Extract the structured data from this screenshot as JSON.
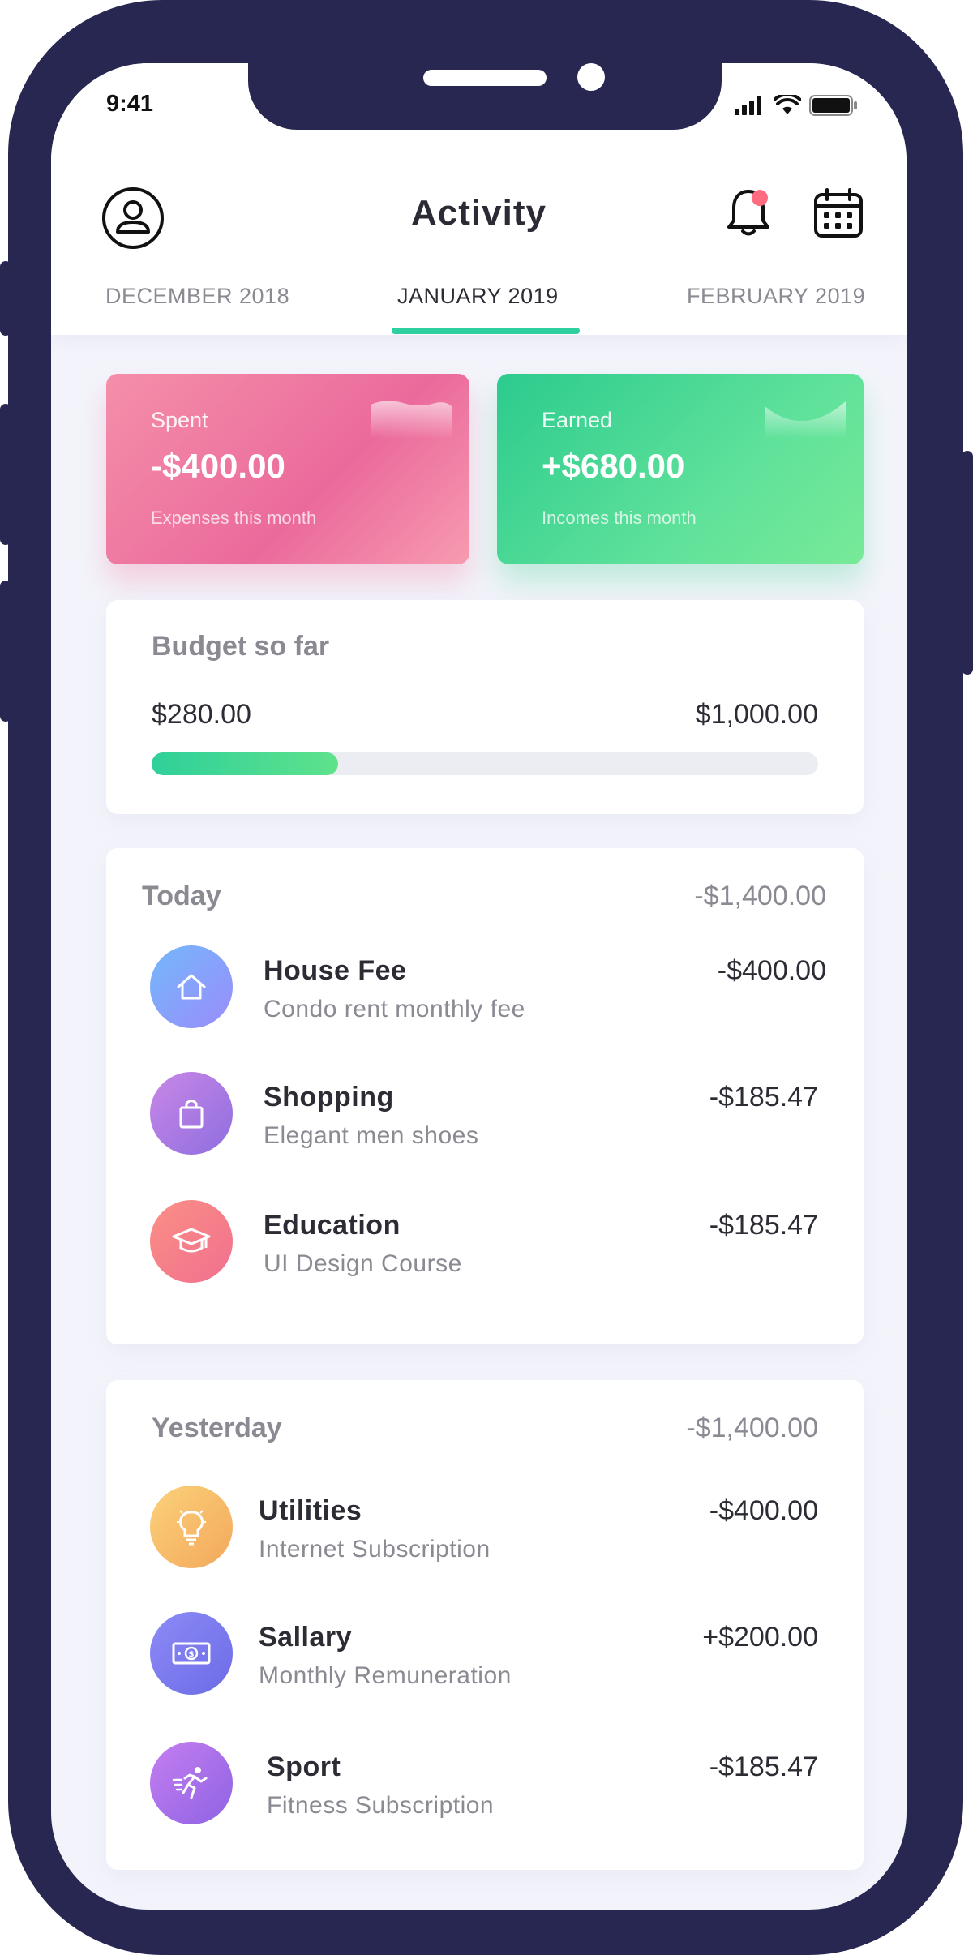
{
  "status_bar": {
    "time": "9:41"
  },
  "header": {
    "title": "Activity"
  },
  "months": [
    {
      "label": "DECEMBER 2018",
      "active": false
    },
    {
      "label": "JANUARY 2019",
      "active": true
    },
    {
      "label": "FEBRUARY 2019",
      "active": false
    }
  ],
  "cards": {
    "spent": {
      "label": "Spent",
      "amount": "-$400.00",
      "sub": "Expenses this month"
    },
    "earned": {
      "label": "Earned",
      "amount": "+$680.00",
      "sub": "Incomes this month"
    }
  },
  "budget": {
    "title": "Budget so far",
    "current": "$280.00",
    "total": "$1,000.00",
    "progress_fraction": 0.28
  },
  "sections": {
    "today": {
      "title": "Today",
      "total": "-$1,400.00",
      "items": [
        {
          "title": "House Fee",
          "subtitle": "Condo rent monthly fee",
          "amount": "-$400.00",
          "icon": "home-icon"
        },
        {
          "title": "Shopping",
          "subtitle": "Elegant men shoes",
          "amount": "-$185.47",
          "icon": "shopping-bag-icon"
        },
        {
          "title": "Education",
          "subtitle": "UI Design Course",
          "amount": "-$185.47",
          "icon": "graduation-cap-icon"
        }
      ]
    },
    "yesterday": {
      "title": "Yesterday",
      "total": "-$1,400.00",
      "items": [
        {
          "title": "Utilities",
          "subtitle": "Internet Subscription",
          "amount": "-$400.00",
          "icon": "lightbulb-icon"
        },
        {
          "title": "Sallary",
          "subtitle": "Monthly Remuneration",
          "amount": "+$200.00",
          "icon": "banknote-icon"
        },
        {
          "title": "Sport",
          "subtitle": "Fitness Subscription",
          "amount": "-$185.47",
          "icon": "running-icon"
        }
      ]
    }
  },
  "colors": {
    "frame": "#272751",
    "accent": "#2fd0a0",
    "spent_gradient": [
      "#f48fa9",
      "#eb6a9c"
    ],
    "earned_gradient": [
      "#2ccb8e",
      "#78ea98"
    ],
    "notification_dot": "#ff6b81"
  }
}
